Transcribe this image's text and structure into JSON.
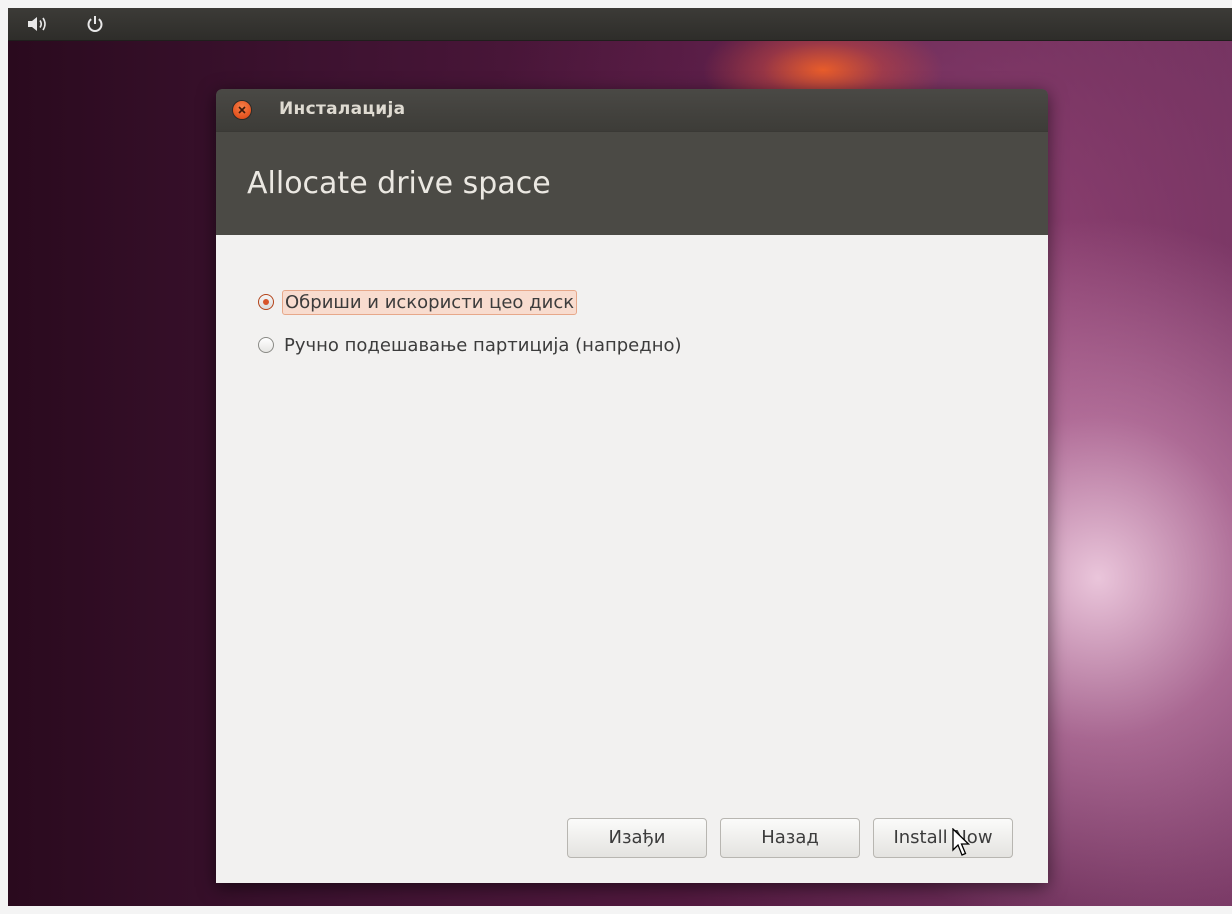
{
  "panel": {
    "icons": [
      "volume-icon",
      "power-icon"
    ]
  },
  "window": {
    "title": "Инсталација",
    "page_title": "Allocate drive space"
  },
  "options": [
    {
      "label": "Обриши и искористи цео диск",
      "selected": true
    },
    {
      "label": "Ручно подешавање партиција (напредно)",
      "selected": false
    }
  ],
  "buttons": {
    "quit": "Изађи",
    "back": "Назад",
    "install": "Install Now"
  },
  "colors": {
    "accent": "#d7542a",
    "header": "#4b4a45",
    "content_bg": "#f2f1f0"
  }
}
